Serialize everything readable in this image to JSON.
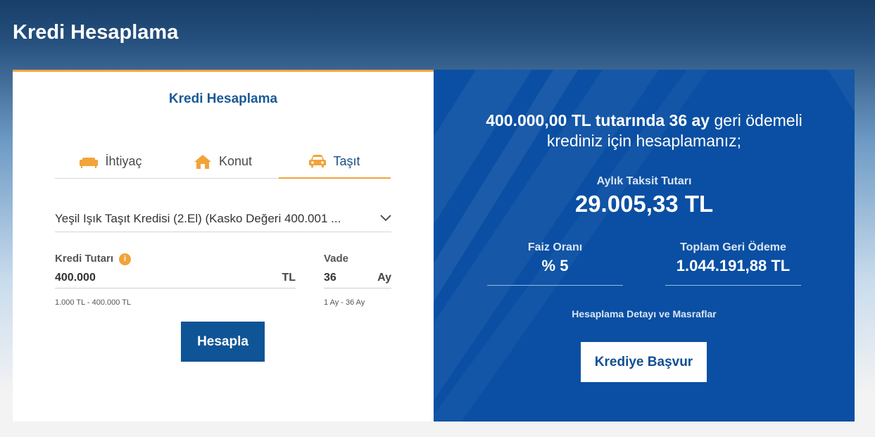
{
  "page": {
    "title": "Kredi Hesaplama"
  },
  "card": {
    "title": "Kredi Hesaplama",
    "tabs": [
      {
        "label": "İhtiyaç",
        "icon": "sofa-icon"
      },
      {
        "label": "Konut",
        "icon": "house-icon"
      },
      {
        "label": "Taşıt",
        "icon": "car-icon",
        "active": true
      }
    ],
    "product": {
      "selected": "Yeşil Işık Taşıt Kredisi (2.El) (Kasko Değeri 400.001 ..."
    },
    "amount": {
      "label": "Kredi Tutarı",
      "info_icon": "i",
      "value": "400.000",
      "unit": "TL",
      "hint": "1.000 TL - 400.000 TL"
    },
    "term": {
      "label": "Vade",
      "value": "36",
      "unit": "Ay",
      "hint": "1 Ay - 36 Ay"
    },
    "calculate_label": "Hesapla"
  },
  "result": {
    "summary_bold1": "400.000,00 TL tutarında 36 ay",
    "summary_rest1": " geri ödemeli",
    "summary_line2": "krediniz için hesaplamanız;",
    "monthly_label": "Aylık Taksit Tutarı",
    "monthly_value": "29.005,33 TL",
    "rate_label": "Faiz Oranı",
    "rate_value": "% 5",
    "total_label": "Toplam Geri Ödeme",
    "total_value": "1.044.191,88 TL",
    "detail_link": "Hesaplama Detayı ve Masraflar",
    "apply_label": "Krediye Başvur"
  },
  "colors": {
    "accent": "#f2a33a",
    "primary": "#0f5496",
    "panel": "#0a4fa3"
  }
}
